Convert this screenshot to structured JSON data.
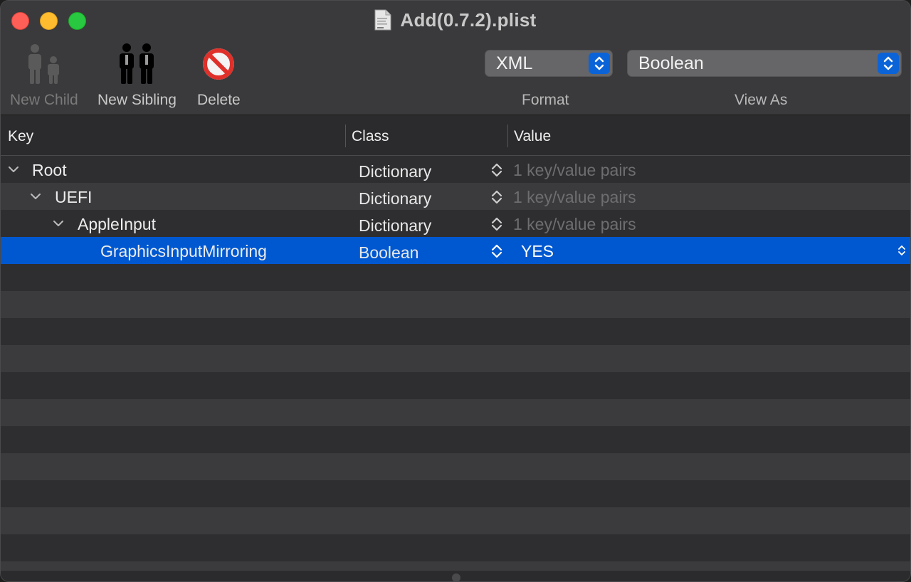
{
  "window": {
    "title": "Add(0.7.2).plist"
  },
  "toolbar": {
    "new_child_label": "New Child",
    "new_sibling_label": "New Sibling",
    "delete_label": "Delete",
    "format_value": "XML",
    "format_label": "Format",
    "view_as_value": "Boolean",
    "view_as_label": "View As"
  },
  "table": {
    "columns": {
      "key": "Key",
      "class": "Class",
      "value": "Value"
    },
    "rows": [
      {
        "key": "Root",
        "class": "Dictionary",
        "value": "1 key/value pairs",
        "depth": 0,
        "expanded": true
      },
      {
        "key": "UEFI",
        "class": "Dictionary",
        "value": "1 key/value pairs",
        "depth": 1,
        "expanded": true
      },
      {
        "key": "AppleInput",
        "class": "Dictionary",
        "value": "1 key/value pairs",
        "depth": 2,
        "expanded": true
      },
      {
        "key": "GraphicsInputMirroring",
        "class": "Boolean",
        "value": "YES",
        "depth": 3,
        "selected": true
      }
    ]
  },
  "colors": {
    "selection": "#0058d0",
    "accent": "#0b63d8",
    "close": "#ff5f57",
    "minimize": "#febc2e",
    "zoom": "#28c840",
    "delete_icon": "#e0302a"
  }
}
